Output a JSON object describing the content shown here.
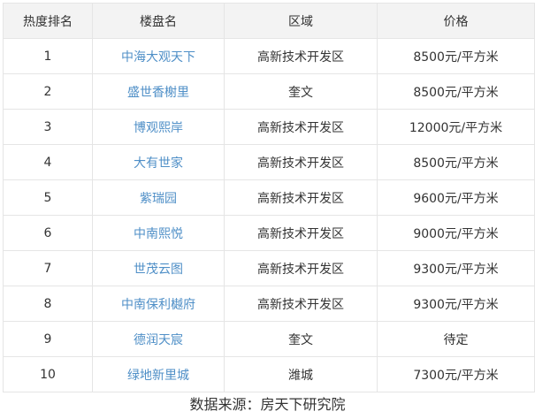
{
  "table": {
    "headers": {
      "rank": "热度排名",
      "name": "楼盘名",
      "area": "区域",
      "price": "价格"
    },
    "rows": [
      {
        "rank": "1",
        "name": "中海大观天下",
        "area": "高新技术开发区",
        "price": "8500元/平方米"
      },
      {
        "rank": "2",
        "name": "盛世香榭里",
        "area": "奎文",
        "price": "8500元/平方米"
      },
      {
        "rank": "3",
        "name": "博观熙岸",
        "area": "高新技术开发区",
        "price": "12000元/平方米"
      },
      {
        "rank": "4",
        "name": "大有世家",
        "area": "高新技术开发区",
        "price": "8500元/平方米"
      },
      {
        "rank": "5",
        "name": "紫瑞园",
        "area": "高新技术开发区",
        "price": "9600元/平方米"
      },
      {
        "rank": "6",
        "name": "中南熙悦",
        "area": "高新技术开发区",
        "price": "9000元/平方米"
      },
      {
        "rank": "7",
        "name": "世茂云图",
        "area": "高新技术开发区",
        "price": "9300元/平方米"
      },
      {
        "rank": "8",
        "name": "中南保利樾府",
        "area": "高新技术开发区",
        "price": "9300元/平方米"
      },
      {
        "rank": "9",
        "name": "德润天宸",
        "area": "奎文",
        "price": "待定"
      },
      {
        "rank": "10",
        "name": "绿地新里城",
        "area": "潍城",
        "price": "7300元/平方米"
      }
    ]
  },
  "footer": {
    "source": "数据来源：房天下研究院"
  },
  "colors": {
    "link": "#4f8fc7",
    "header_bg": "#f3f3f3",
    "border": "#e5e5e5",
    "text": "#333333"
  }
}
